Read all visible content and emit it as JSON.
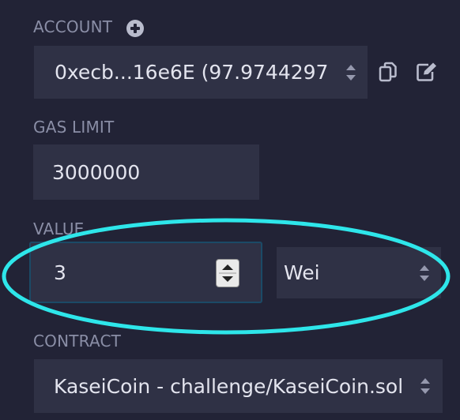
{
  "account": {
    "label": "ACCOUNT",
    "value": "0xecb...16e6E (97.9744297"
  },
  "gas_limit": {
    "label": "GAS LIMIT",
    "value": "3000000"
  },
  "value": {
    "label": "VALUE",
    "amount": "3",
    "unit": "Wei"
  },
  "contract": {
    "label": "CONTRACT",
    "selected": "KaseiCoin - challenge/KaseiCoin.sol"
  },
  "colors": {
    "background": "#222336",
    "field": "#2f3145",
    "label": "#8a8ea6",
    "text": "#e3e4ee",
    "highlight_ellipse": "#2ee6ea"
  },
  "icons": [
    "plus-circle-icon",
    "copy-icon",
    "edit-icon",
    "select-arrows-icon",
    "spinner-arrows-icon"
  ]
}
